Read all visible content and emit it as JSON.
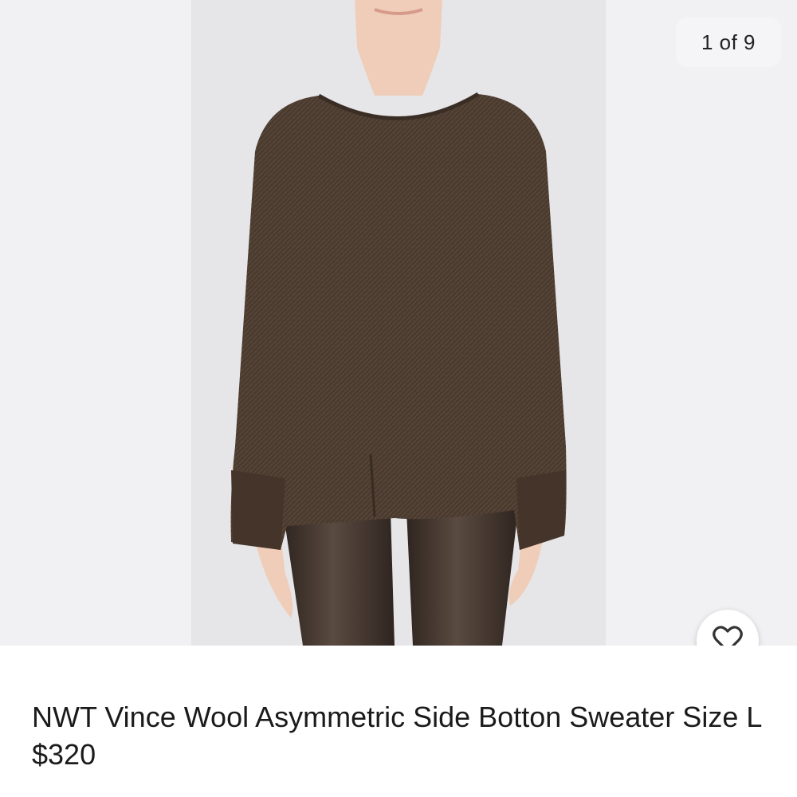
{
  "gallery": {
    "counter": "1 of 9"
  },
  "listing": {
    "title": "NWT Vince Wool Asymmetric Side Botton Sweater Size L $320"
  },
  "icons": {
    "favorite": "heart-outline-icon"
  },
  "colors": {
    "sweater": "#4a3a2e",
    "leggings": "#3e3029",
    "skin": "#efcdb9",
    "photo_bg": "#e6e6e9"
  }
}
